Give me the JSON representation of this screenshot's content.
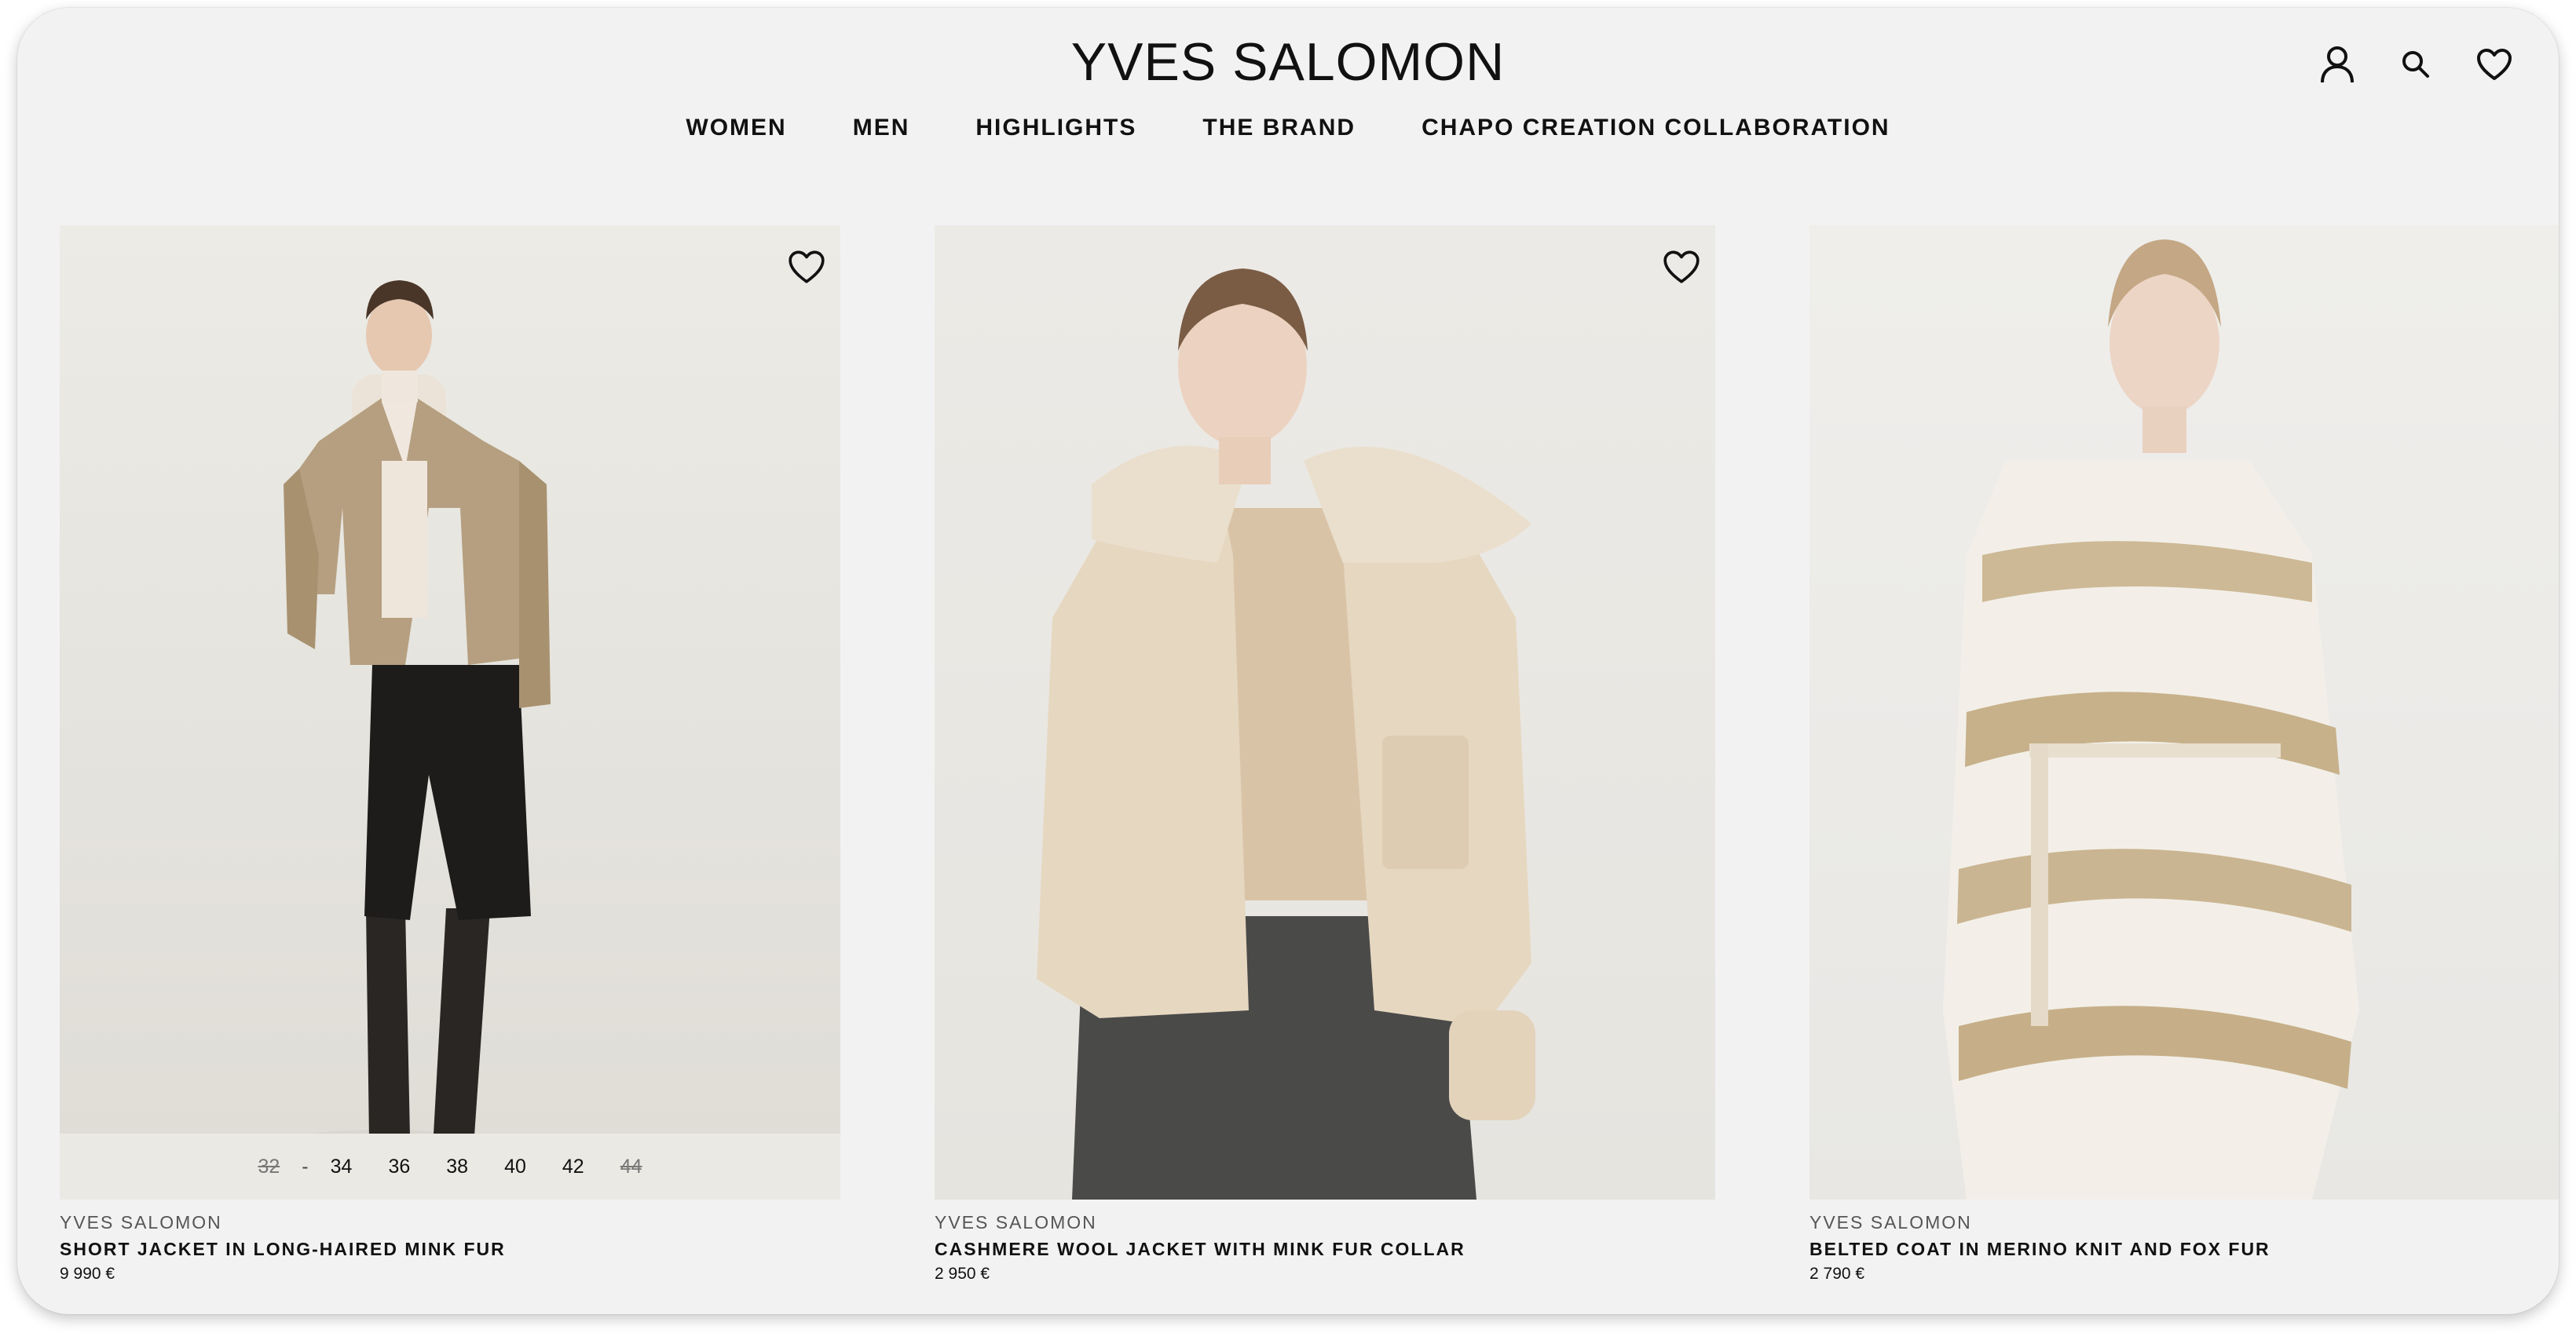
{
  "brand": "YVES SALOMON",
  "nav": [
    "WOMEN",
    "MEN",
    "HIGHLIGHTS",
    "THE BRAND",
    "CHAPO CREATION COLLABORATION"
  ],
  "icons": {
    "account": "user-icon",
    "search": "search-icon",
    "wishlist": "heart-icon"
  },
  "products": [
    {
      "maker": "YVES SALOMON",
      "name": "SHORT JACKET IN LONG-HAIRED MINK FUR",
      "price": "9 990 €",
      "sizes": {
        "s0": "32",
        "sep": "-",
        "s1": "34",
        "s2": "36",
        "s3": "38",
        "s4": "40",
        "s5": "42",
        "s6": "44"
      },
      "unavailable": [
        "32",
        "44"
      ]
    },
    {
      "maker": "YVES SALOMON",
      "name": "CASHMERE WOOL JACKET WITH MINK FUR COLLAR",
      "price": "2 950 €"
    },
    {
      "maker": "YVES SALOMON",
      "name": "BELTED COAT IN MERINO KNIT AND FOX FUR",
      "price": "2 790 €"
    }
  ],
  "colors": {
    "background": "#f3f2f3",
    "text": "#111111",
    "muted": "#555555"
  }
}
